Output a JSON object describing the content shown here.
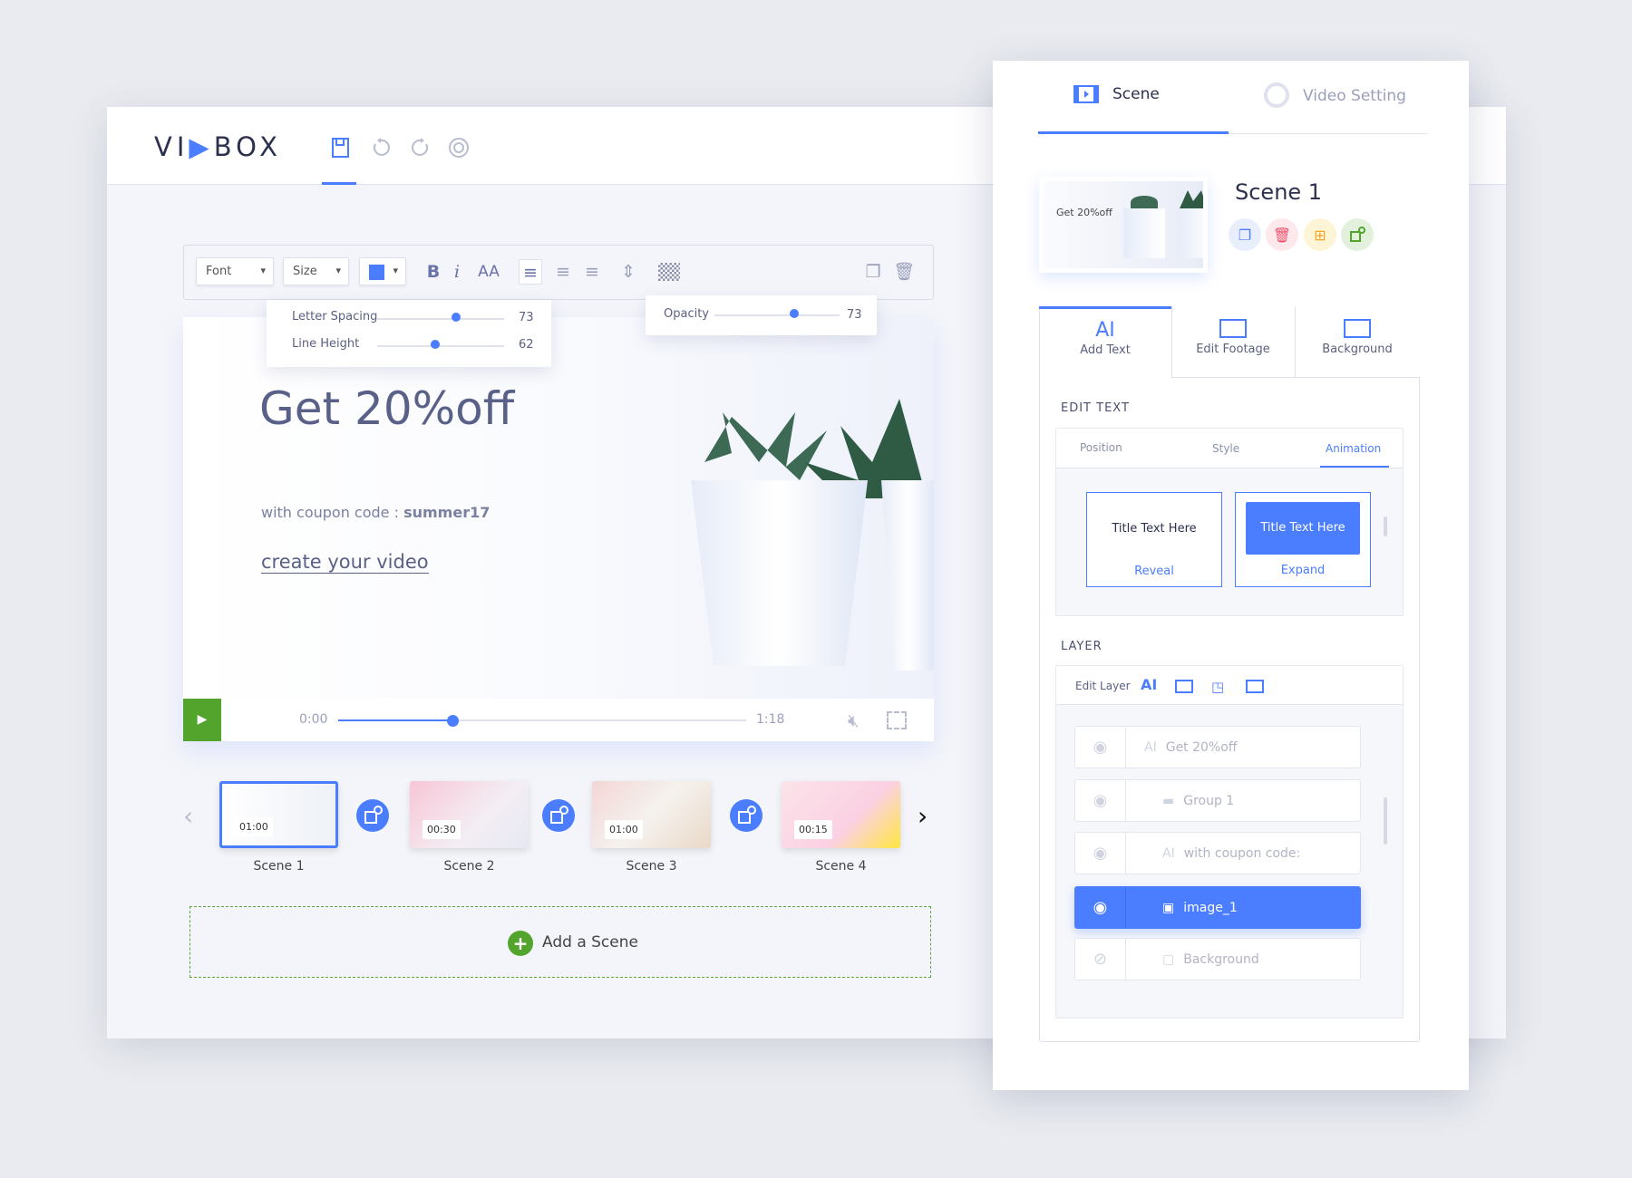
{
  "brand": {
    "logo_pre": "VI",
    "logo_post": "BOX"
  },
  "header": {
    "icons": [
      "save-icon",
      "undo-icon",
      "redo-icon",
      "help-icon"
    ]
  },
  "toolbar": {
    "font": "Font",
    "size": "Size",
    "color": "#4a7dff",
    "bold": "B",
    "italic": "i",
    "case": "AA"
  },
  "letter_popup": {
    "letter_spacing_label": "Letter Spacing",
    "letter_spacing": 73,
    "line_height_label": "Line Height",
    "line_height": 62
  },
  "opacity_popup": {
    "label": "Opacity",
    "value": 73
  },
  "canvas": {
    "headline": "Get 20%off",
    "sub_pre": "with coupon code : ",
    "code": "summer17",
    "link": "create your video"
  },
  "player": {
    "current": "0:00",
    "total": "1:18",
    "progress": 0.28
  },
  "scenes": [
    {
      "label": "Scene 1",
      "duration": "01:00"
    },
    {
      "label": "Scene 2",
      "duration": "00:30"
    },
    {
      "label": "Scene 3",
      "duration": "01:00"
    },
    {
      "label": "Scene 4",
      "duration": "00:15"
    }
  ],
  "add_scene": "Add a Scene",
  "panel": {
    "tab_scene": "Scene",
    "tab_video": "Video Setting",
    "scene_title": "Scene 1",
    "thumb": {
      "headline": "Get 20%off"
    },
    "tools": [
      "Add Text",
      "Edit Footage",
      "Background"
    ],
    "edit_text": "EDIT TEXT",
    "subtabs": [
      "Position",
      "Style",
      "Animation"
    ],
    "animations": [
      {
        "title": "Title Text Here",
        "name": "Reveal"
      },
      {
        "title": "Title Text Here",
        "name": "Expand"
      }
    ],
    "layer": "LAYER",
    "edit_layer": "Edit Layer",
    "layers": [
      {
        "name": "Get 20%off",
        "icon": "text"
      },
      {
        "name": "Group 1",
        "icon": "folder"
      },
      {
        "name": "with coupon code:",
        "icon": "text"
      },
      {
        "name": "image_1",
        "icon": "image",
        "selected": true
      },
      {
        "name": "Background",
        "icon": "rect",
        "hidden": true
      }
    ]
  },
  "colors": {
    "accent": "#4a7dff",
    "green": "#52a42d"
  }
}
